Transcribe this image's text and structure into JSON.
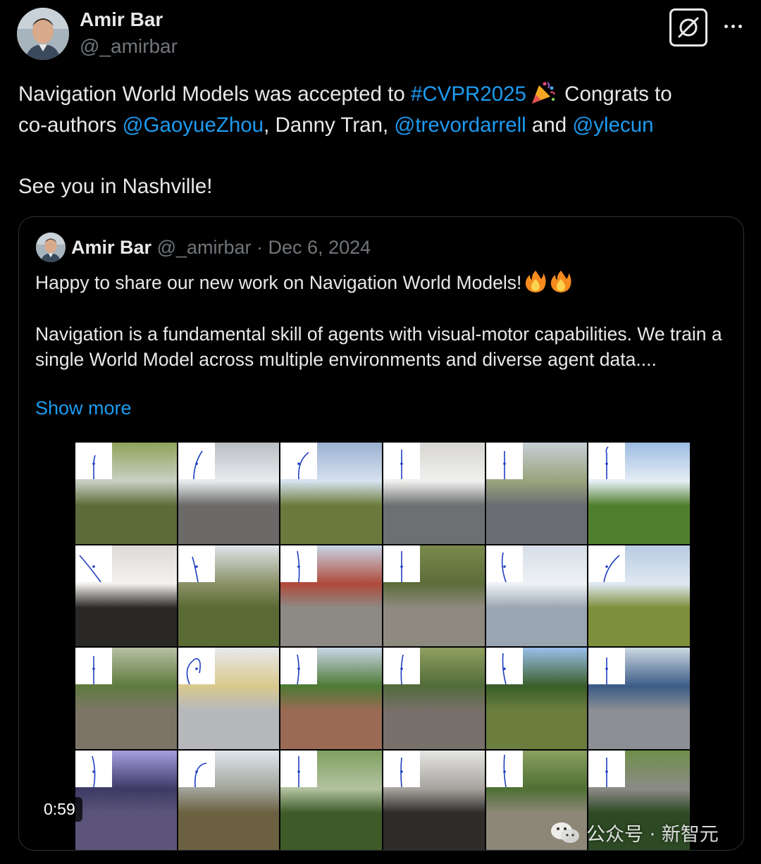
{
  "author": {
    "name": "Amir Bar",
    "handle": "@_amirbar"
  },
  "header_icons": {
    "grok": "grok-icon",
    "more": "more-options-icon"
  },
  "tweet": {
    "line1_a": "Navigation World Models was accepted to ",
    "hashtag": "#CVPR2025",
    "line1_b": " Congrats to",
    "line2_a": "co-authors ",
    "mention1": "@GaoyueZhou",
    "line2_b": ", Danny Tran, ",
    "mention2": "@trevordarrell",
    "line2_c": " and ",
    "mention3": "@ylecun",
    "line3": "See you in Nashville!"
  },
  "quote": {
    "name": "Amir Bar",
    "handle": "@_amirbar",
    "separator": " · ",
    "date": "Dec 6, 2024",
    "line1": "Happy to share our new work on Navigation World Models!",
    "body": "Navigation is a fundamental skill of agents with visual-motor capabilities. We train a single World Model across multiple environments and diverse agent data....",
    "show_more": "Show more"
  },
  "video": {
    "duration": "0:59"
  },
  "watermark": {
    "text": "公众号 · 新智元"
  },
  "colors": {
    "background": "#000000",
    "text": "#e7e9ea",
    "secondary": "#71767b",
    "link": "#1d9bf0",
    "border": "#2f3336"
  }
}
